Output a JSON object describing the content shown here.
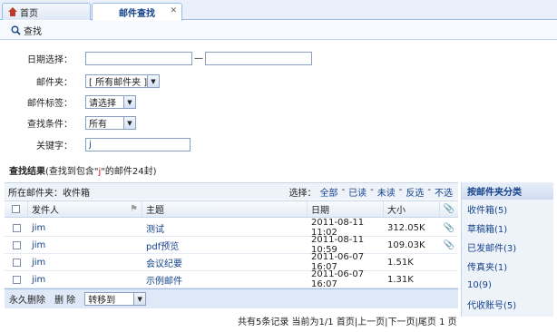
{
  "tabs": [
    {
      "label": "首页"
    },
    {
      "label": "邮件查找"
    }
  ],
  "toolbar": {
    "search_label": "查找"
  },
  "form": {
    "date_label": "日期选择：",
    "date_from": "",
    "date_sep": "—",
    "date_to": "",
    "folder_label": "邮件夹：",
    "folder_value": "[ 所有邮件夹 ]",
    "tag_label": "邮件标签：",
    "tag_value": "请选择",
    "condition_label": "查找条件：",
    "condition_value": "所有",
    "keyword_label": "关键字：",
    "keyword_value": "j"
  },
  "result": {
    "title": "查找结果",
    "desc_prefix": "(查找到包含\"",
    "keyword": "j",
    "desc_suffix": "\"的邮件24封)"
  },
  "folder_bar": {
    "current": "所在邮件夹：收件箱",
    "select_label": "选择：",
    "links": [
      "全部",
      "已读",
      "未读",
      "反选",
      "不选"
    ]
  },
  "grid": {
    "headers": {
      "sender": "发件人",
      "subject": "主题",
      "date": "日期",
      "size": "大小"
    },
    "rows": [
      {
        "sender": "jim",
        "subject": "测试",
        "date": "2011-08-11 11:02",
        "size": "312.05K",
        "attach": true
      },
      {
        "sender": "jim",
        "subject": "pdf预览",
        "date": "2011-08-11 10:59",
        "size": "109.03K",
        "attach": true
      },
      {
        "sender": "jim",
        "subject": "会议纪要",
        "date": "2011-06-07 16:07",
        "size": "1.51K",
        "attach": false
      },
      {
        "sender": "jim",
        "subject": "示例邮件",
        "date": "2011-06-07 16:07",
        "size": "1.31K",
        "attach": false
      }
    ]
  },
  "bottom": {
    "delete_forever": "永久删除",
    "delete": "删 除",
    "move_to": "转移到"
  },
  "pager": {
    "text": "共有5条记录  当前为1/1 首页|上一页|下一页|尾页   1  页"
  },
  "side": {
    "title": "按邮件夹分类",
    "items": [
      "收件箱(5)",
      "草稿箱(1)",
      "已发邮件(3)",
      "传真夹(1)",
      "10(9)",
      "代收账号(5)"
    ]
  },
  "colors": {
    "accent": "#15428b",
    "border": "#99bbe8",
    "highlight": "#dd0000"
  }
}
